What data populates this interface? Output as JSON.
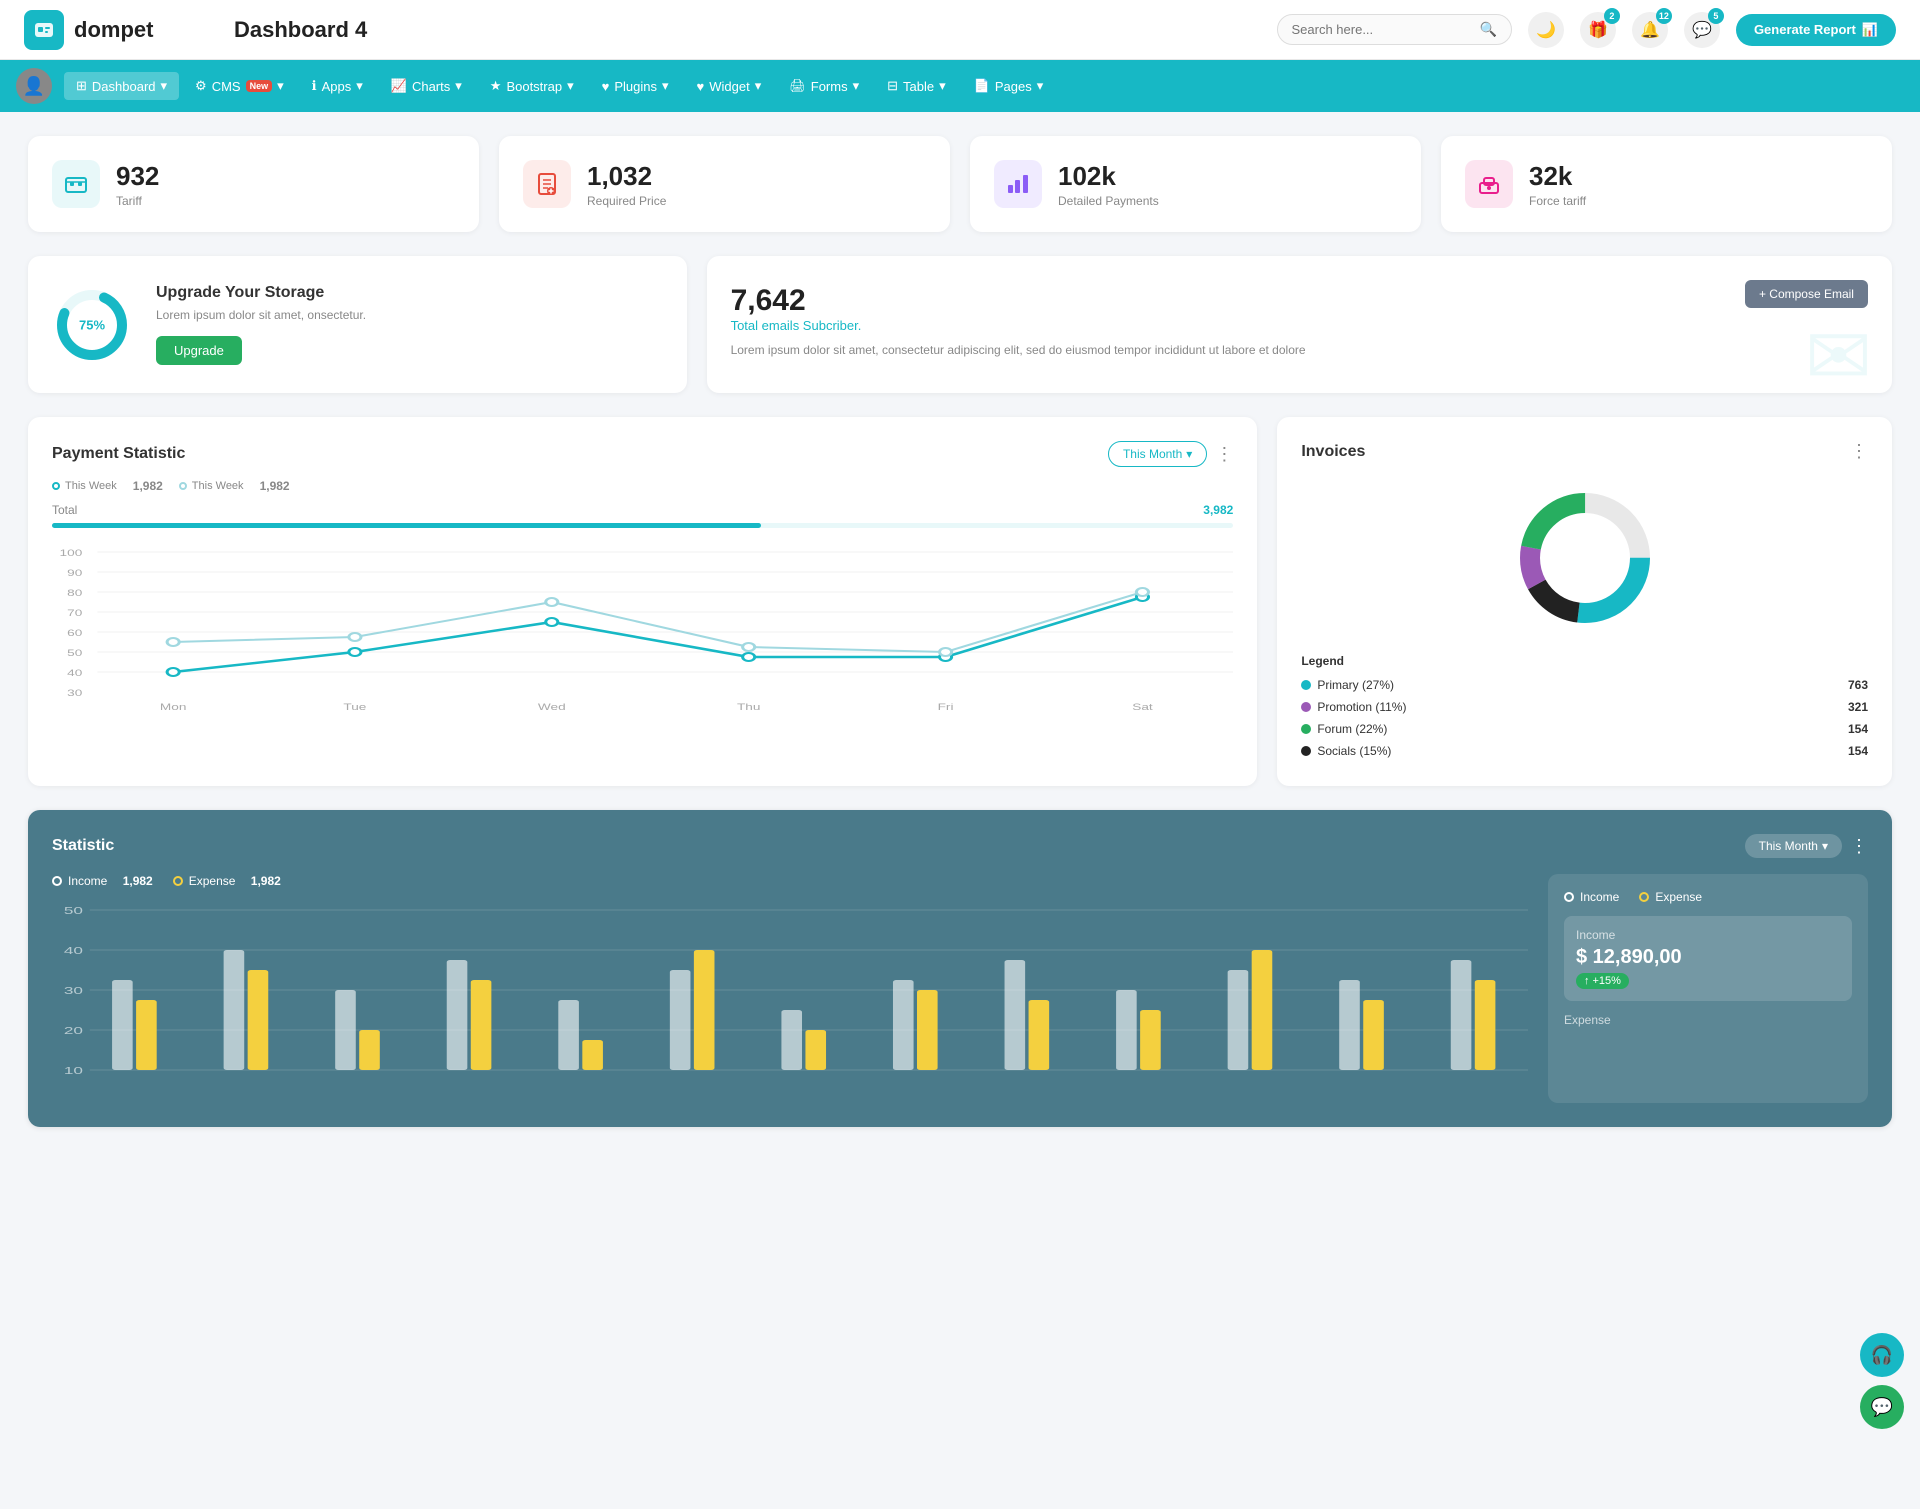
{
  "header": {
    "logo_text": "dompet",
    "page_title": "Dashboard 4",
    "search_placeholder": "Search here...",
    "generate_btn_label": "Generate Report",
    "icons": {
      "moon": "🌙",
      "gift": "🎁",
      "bell": "🔔",
      "chat": "💬"
    },
    "badges": {
      "gift": "2",
      "bell": "12",
      "chat": "5"
    }
  },
  "nav": {
    "items": [
      {
        "id": "dashboard",
        "label": "Dashboard",
        "active": true,
        "has_dropdown": true
      },
      {
        "id": "cms",
        "label": "CMS",
        "active": false,
        "has_new": true,
        "has_dropdown": true
      },
      {
        "id": "apps",
        "label": "Apps",
        "active": false,
        "has_dropdown": true
      },
      {
        "id": "charts",
        "label": "Charts",
        "active": false,
        "has_dropdown": true
      },
      {
        "id": "bootstrap",
        "label": "Bootstrap",
        "active": false,
        "has_dropdown": true
      },
      {
        "id": "plugins",
        "label": "Plugins",
        "active": false,
        "has_dropdown": true
      },
      {
        "id": "widget",
        "label": "Widget",
        "active": false,
        "has_dropdown": true
      },
      {
        "id": "forms",
        "label": "Forms",
        "active": false,
        "has_dropdown": true
      },
      {
        "id": "table",
        "label": "Table",
        "active": false,
        "has_dropdown": true
      },
      {
        "id": "pages",
        "label": "Pages",
        "active": false,
        "has_dropdown": true
      }
    ]
  },
  "stat_cards": [
    {
      "id": "tariff",
      "value": "932",
      "label": "Tariff",
      "icon": "briefcase",
      "icon_class": "teal"
    },
    {
      "id": "required_price",
      "value": "1,032",
      "label": "Required Price",
      "icon": "file",
      "icon_class": "red"
    },
    {
      "id": "detailed_payments",
      "value": "102k",
      "label": "Detailed Payments",
      "icon": "chart",
      "icon_class": "purple"
    },
    {
      "id": "force_tariff",
      "value": "32k",
      "label": "Force tariff",
      "icon": "building",
      "icon_class": "pink"
    }
  ],
  "storage": {
    "percent": "75%",
    "title": "Upgrade Your Storage",
    "description": "Lorem ipsum dolor sit amet, onsectetur.",
    "btn_label": "Upgrade",
    "circle_percent": 75
  },
  "email": {
    "count": "7,642",
    "subtitle": "Total emails Subcriber.",
    "description": "Lorem ipsum dolor sit amet, consectetur adipiscing elit, sed do eiusmod tempor incididunt ut labore et dolore",
    "compose_btn": "+ Compose Email"
  },
  "payment": {
    "title": "Payment Statistic",
    "filter_label": "This Month",
    "legend": [
      {
        "id": "this_week_1",
        "label": "This Week",
        "value": "1,982"
      },
      {
        "id": "this_week_2",
        "label": "This Week",
        "value": "1,982"
      }
    ],
    "total_label": "Total",
    "total_value": "3,982",
    "chart": {
      "x_labels": [
        "Mon",
        "Tue",
        "Wed",
        "Thu",
        "Fri",
        "Sat"
      ],
      "y_labels": [
        "100",
        "90",
        "80",
        "70",
        "60",
        "50",
        "40",
        "30"
      ],
      "line1_points": "40,140 130,110 260,80 390,120 500,120 640,50 760,55",
      "line2_points": "40,110 130,100 260,60 390,110 500,115 640,45 760,45"
    }
  },
  "invoices": {
    "title": "Invoices",
    "legend": [
      {
        "id": "primary",
        "label": "Primary (27%)",
        "value": "763",
        "color": "#17b8c5"
      },
      {
        "id": "promotion",
        "label": "Promotion (11%)",
        "value": "321",
        "color": "#9b59b6"
      },
      {
        "id": "forum",
        "label": "Forum (22%)",
        "value": "154",
        "color": "#27ae60"
      },
      {
        "id": "socials",
        "label": "Socials (15%)",
        "value": "154",
        "color": "#222"
      }
    ],
    "legend_title": "Legend"
  },
  "statistic": {
    "title": "Statistic",
    "filter_label": "This Month",
    "income": {
      "label": "Income",
      "value": "1,982"
    },
    "expense": {
      "label": "Expense",
      "value": "1,982"
    },
    "income_panel": {
      "label": "Income",
      "value": "$ 12,890,00",
      "badge": "+15%"
    },
    "expense_panel_label": "Expense"
  },
  "colors": {
    "teal": "#17b8c5",
    "purple": "#8b5cf6",
    "pink": "#e91e8c",
    "red": "#e74c3c",
    "green": "#27ae60",
    "dark_bg": "#4a7a8a"
  }
}
